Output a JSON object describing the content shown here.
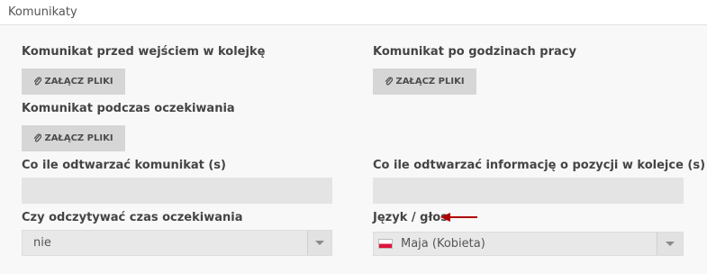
{
  "section": {
    "title": "Komunikaty"
  },
  "fields": {
    "pre_queue": {
      "label": "Komunikat przed wejściem w kolejkę",
      "button_label": "ZAŁĄCZ PLIKI"
    },
    "after_hours": {
      "label": "Komunikat po godzinach pracy",
      "button_label": "ZAŁĄCZ PLIKI"
    },
    "waiting": {
      "label": "Komunikat podczas oczekiwania",
      "button_label": "ZAŁĄCZ PLIKI"
    },
    "repeat_message": {
      "label": "Co ile odtwarzać komunikat (s)",
      "value": ""
    },
    "repeat_position": {
      "label": "Co ile odtwarzać informację o pozycji w kolejce (s)",
      "value": ""
    },
    "read_wait_time": {
      "label": "Czy odczytywać czas oczekiwania",
      "selected": "nie",
      "options": [
        "nie"
      ]
    },
    "language_voice": {
      "label": "Język / głos",
      "selected": "Maja (Kobieta)",
      "flag": "poland-flag-icon"
    }
  },
  "icons": {
    "attach": "paperclip-icon",
    "dropdown": "chevron-down-icon",
    "annotation": "red-arrow-icon"
  },
  "colors": {
    "annotation_arrow": "#b00000",
    "button_bg": "#d6d6d6",
    "input_bg": "#e4e4e4"
  }
}
